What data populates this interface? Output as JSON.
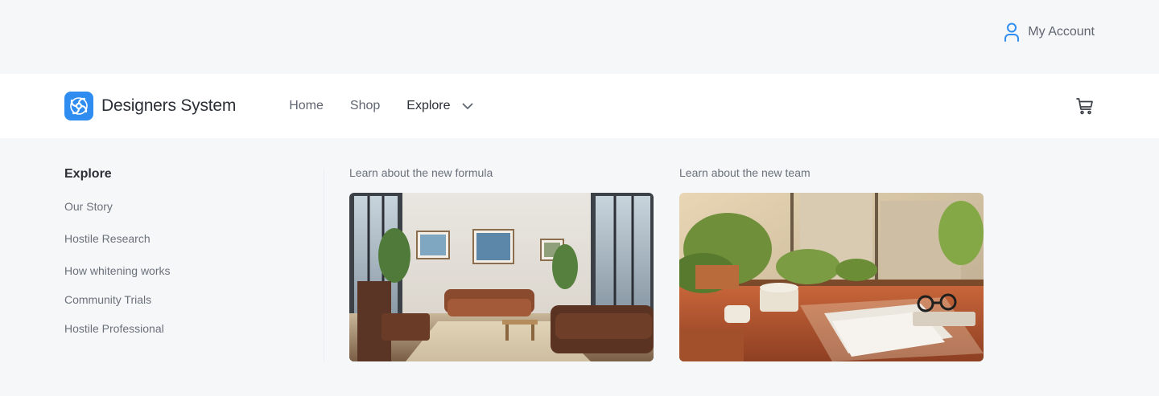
{
  "account": {
    "label": "My Account",
    "icon": "user-icon"
  },
  "brand": {
    "name": "Designers System",
    "logo_icon": "swirl-logo-icon",
    "color": "#2f8cf0"
  },
  "nav": {
    "links": [
      {
        "label": "Home"
      },
      {
        "label": "Shop"
      },
      {
        "label": "Explore",
        "active": true
      }
    ],
    "cart_icon": "cart-icon"
  },
  "dropdown": {
    "title": "Explore",
    "items": [
      {
        "label": "Our Story"
      },
      {
        "label": "Hostile Research"
      },
      {
        "label": "How whitening works"
      },
      {
        "label": "Community Trials"
      },
      {
        "label": "Hostile Professional"
      }
    ],
    "cards": [
      {
        "label": "Learn about the new formula",
        "image": "living-room-photo"
      },
      {
        "label": "Learn about the new team",
        "image": "sunny-desk-plants-photo"
      }
    ]
  }
}
